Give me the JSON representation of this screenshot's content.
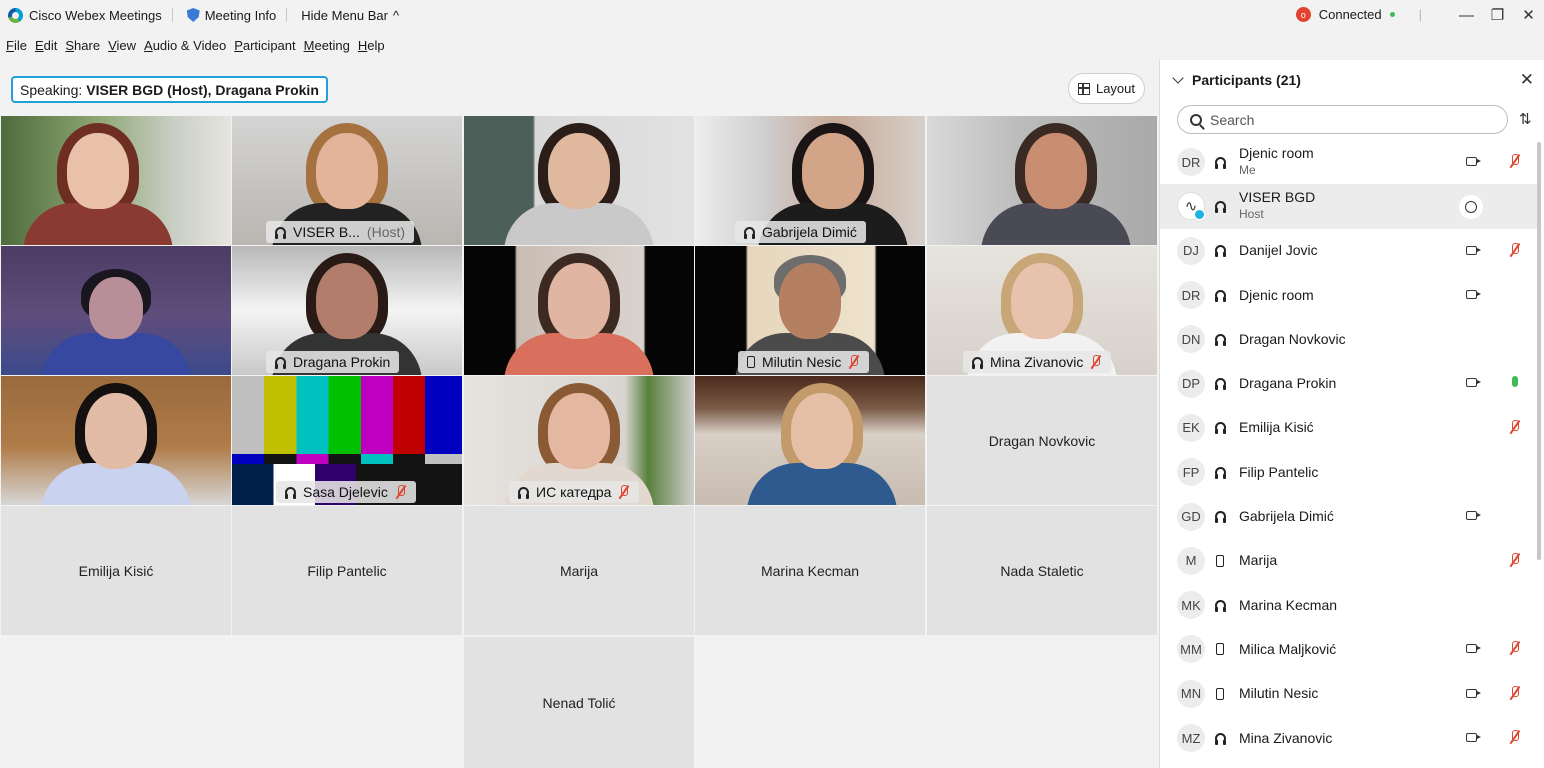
{
  "titlebar": {
    "app_title": "Cisco Webex Meetings",
    "meeting_info": "Meeting Info",
    "hide_menu": "Hide Menu Bar",
    "record_badge": "o",
    "connection": "Connected",
    "separator": "|",
    "minimize": "—",
    "restore": "❐",
    "close": "✕"
  },
  "menu": [
    "File",
    "Edit",
    "Share",
    "View",
    "Audio & Video",
    "Participant",
    "Meeting",
    "Help"
  ],
  "speaking": {
    "label": "Speaking:",
    "names": "VISER BGD (Host), Dragana Prokin"
  },
  "layout_button": "Layout",
  "tiles": {
    "t1": {
      "name": ""
    },
    "t2": {
      "name": "VISER B...",
      "host": "(Host)"
    },
    "t3": {
      "name": ""
    },
    "t4": {
      "name": "Gabrijela Dimić"
    },
    "t5": {
      "name": ""
    },
    "t6": {
      "name": ""
    },
    "t7": {
      "name": "Dragana Prokin"
    },
    "t8": {
      "name": ""
    },
    "t9": {
      "name": "Milutin Nesic"
    },
    "t10": {
      "name": "Mina Zivanovic"
    },
    "t11": {
      "name": ""
    },
    "t12": {
      "name": "Sasa Djelevic"
    },
    "t13": {
      "name": "ИС катедра"
    },
    "t14": {
      "name": ""
    },
    "t15": {
      "name": "Dragan Novkovic"
    },
    "t16": {
      "name": "Emilija Kisić"
    },
    "t17": {
      "name": "Filip Pantelic"
    },
    "t18": {
      "name": "Marija"
    },
    "t19": {
      "name": "Marina Kecman"
    },
    "t20": {
      "name": "Nada Staletic"
    },
    "t21": {
      "name": "Nenad Tolić"
    }
  },
  "panel": {
    "title": "Participants (21)",
    "close": "✕",
    "search_placeholder": "Search",
    "sort_icon": "⇅",
    "participants": [
      {
        "initials": "DR",
        "name": "Djenic room",
        "sub": "Me",
        "device": "headset",
        "video": true,
        "mic": "muted"
      },
      {
        "initials": "∿",
        "name": "VISER BGD",
        "sub": "Host",
        "device": "headset",
        "video": false,
        "mic": "chat"
      },
      {
        "initials": "DJ",
        "name": "Danijel Jovic",
        "sub": "",
        "device": "headset",
        "video": true,
        "mic": "muted"
      },
      {
        "initials": "DR",
        "name": "Djenic room",
        "sub": "",
        "device": "headset",
        "video": true,
        "mic": ""
      },
      {
        "initials": "DN",
        "name": "Dragan Novkovic",
        "sub": "",
        "device": "headset",
        "video": false,
        "mic": ""
      },
      {
        "initials": "DP",
        "name": "Dragana Prokin",
        "sub": "",
        "device": "headset",
        "video": true,
        "mic": "on"
      },
      {
        "initials": "EK",
        "name": "Emilija Kisić",
        "sub": "",
        "device": "headset",
        "video": false,
        "mic": "muted"
      },
      {
        "initials": "FP",
        "name": "Filip Pantelic",
        "sub": "",
        "device": "headset",
        "video": false,
        "mic": ""
      },
      {
        "initials": "GD",
        "name": "Gabrijela Dimić",
        "sub": "",
        "device": "headset",
        "video": true,
        "mic": ""
      },
      {
        "initials": "M",
        "name": "Marija",
        "sub": "",
        "device": "phone",
        "video": false,
        "mic": "muted"
      },
      {
        "initials": "MK",
        "name": "Marina Kecman",
        "sub": "",
        "device": "headset",
        "video": false,
        "mic": ""
      },
      {
        "initials": "MM",
        "name": "Milica Maljković",
        "sub": "",
        "device": "phone",
        "video": true,
        "mic": "muted"
      },
      {
        "initials": "MN",
        "name": "Milutin Nesic",
        "sub": "",
        "device": "phone",
        "video": true,
        "mic": "muted"
      },
      {
        "initials": "MZ",
        "name": "Mina Zivanovic",
        "sub": "",
        "device": "headset",
        "video": true,
        "mic": "muted"
      }
    ]
  },
  "colors": {
    "accent": "#1fb3e4",
    "muted": "#e0442f",
    "mic_on": "#3dbb54"
  }
}
